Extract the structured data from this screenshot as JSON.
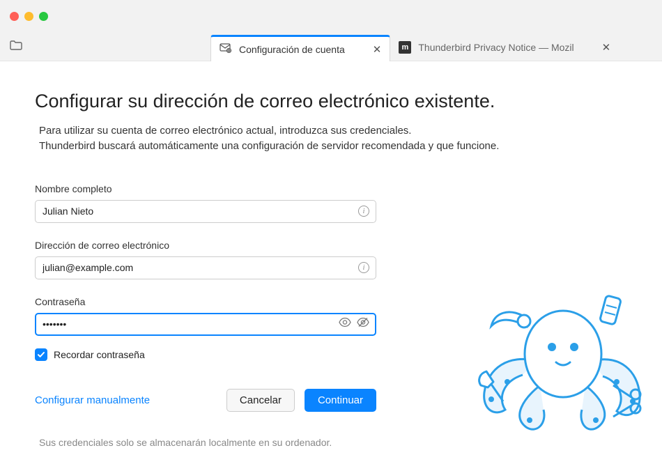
{
  "tabs": {
    "active": {
      "label": "Configuración de cuenta"
    },
    "inactive": {
      "label": "Thunderbird Privacy Notice — Mozil",
      "favicon": "m"
    }
  },
  "page": {
    "title": "Configurar su dirección de correo electrónico existente.",
    "subtitle_line1": "Para utilizar su cuenta de correo electrónico actual, introduzca sus credenciales.",
    "subtitle_line2": "Thunderbird buscará automáticamente una configuración de servidor recomendada y que funcione.",
    "footer": "Sus credenciales solo se almacenarán localmente en su ordenador."
  },
  "form": {
    "name": {
      "label": "Nombre completo",
      "value": "Julian Nieto"
    },
    "email": {
      "label": "Dirección de correo electrónico",
      "value": "julian@example.com"
    },
    "password": {
      "label": "Contraseña",
      "value": "•••••••"
    },
    "remember": {
      "label": "Recordar contraseña",
      "checked": true
    }
  },
  "buttons": {
    "manual": "Configurar manualmente",
    "cancel": "Cancelar",
    "continue": "Continuar"
  }
}
